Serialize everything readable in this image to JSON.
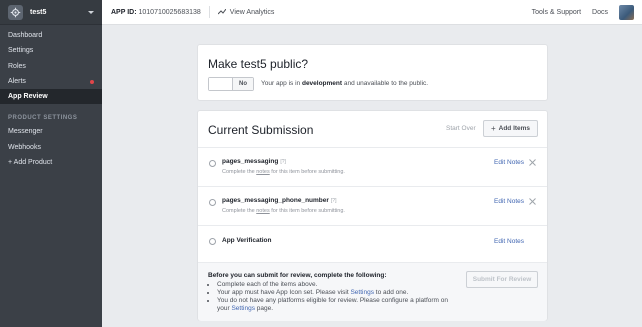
{
  "sidebar": {
    "app_name": "test5",
    "items": [
      {
        "label": "Dashboard"
      },
      {
        "label": "Settings"
      },
      {
        "label": "Roles"
      },
      {
        "label": "Alerts"
      },
      {
        "label": "App Review"
      }
    ],
    "section_label": "PRODUCT SETTINGS",
    "product_items": [
      {
        "label": "Messenger"
      },
      {
        "label": "Webhooks"
      },
      {
        "label": "+ Add Product"
      }
    ]
  },
  "topbar": {
    "app_id_label": "APP ID:",
    "app_id_value": "1010710025683138",
    "view_analytics": "View Analytics",
    "tools_support": "Tools & Support",
    "docs": "Docs"
  },
  "public_card": {
    "title": "Make test5 public?",
    "toggle_label": "No",
    "desc_prefix": "Your app is in ",
    "desc_bold": "development",
    "desc_suffix": " and unavailable to the public."
  },
  "submission": {
    "title": "Current Submission",
    "start_over": "Start Over",
    "add_items": "Add Items",
    "items": [
      {
        "name": "pages_messaging",
        "qmark": "[?]",
        "sub_prefix": "Complete the ",
        "sub_link": "notes",
        "sub_suffix": " for this item before submitting.",
        "edit": "Edit Notes"
      },
      {
        "name": "pages_messaging_phone_number",
        "qmark": "[?]",
        "sub_prefix": "Complete the ",
        "sub_link": "notes",
        "sub_suffix": " for this item before submitting.",
        "edit": "Edit Notes"
      },
      {
        "name": "App Verification",
        "edit": "Edit Notes"
      }
    ],
    "footer": {
      "heading": "Before you can submit for review, complete the following:",
      "bullet1": "Complete each of the items above.",
      "bullet2_prefix": "Your app must have App Icon set. Please visit ",
      "bullet2_link": "Settings",
      "bullet2_suffix": " to add one.",
      "bullet3_prefix": "You do not have any platforms eligible for review. Please configure a platform on your ",
      "bullet3_link": "Settings",
      "bullet3_suffix": " page.",
      "submit_button": "Submit For Review"
    }
  },
  "colors": {
    "sidebar_bg": "#3b4047",
    "link_blue": "#4267b2",
    "alert_dot": "#e0464a"
  }
}
